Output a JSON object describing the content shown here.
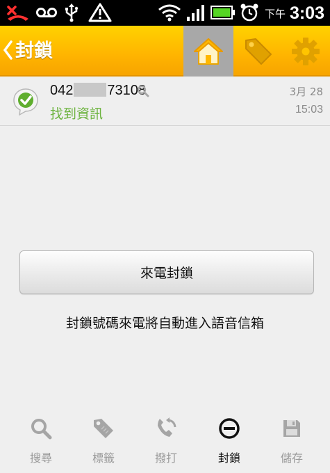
{
  "status_bar": {
    "ampm": "下午",
    "time": "3:03",
    "icons": [
      "missed-call-icon",
      "voicemail-icon",
      "usb-icon",
      "warning-icon",
      "wifi-icon",
      "signal-icon",
      "battery-icon",
      "alarm-icon"
    ]
  },
  "action_bar": {
    "title": "封鎖",
    "buttons": [
      "home-icon",
      "tag-icon",
      "gear-icon"
    ],
    "active_button": "home-icon",
    "accent_color": "#ffc000"
  },
  "entry": {
    "number_prefix": "042",
    "number_suffix": "73108",
    "status": "找到資訊",
    "date": "3月 28",
    "time": "15:03",
    "status_color": "#6cb33e"
  },
  "main": {
    "button_label": "來電封鎖",
    "description": "封鎖號碼來電將自動進入語音信箱"
  },
  "bottom_nav": {
    "items": [
      {
        "label": "搜尋",
        "icon": "search-icon"
      },
      {
        "label": "標籤",
        "icon": "tag-icon"
      },
      {
        "label": "撥打",
        "icon": "call-icon"
      },
      {
        "label": "封鎖",
        "icon": "block-icon"
      },
      {
        "label": "儲存",
        "icon": "save-icon"
      }
    ],
    "active_index": 3
  }
}
